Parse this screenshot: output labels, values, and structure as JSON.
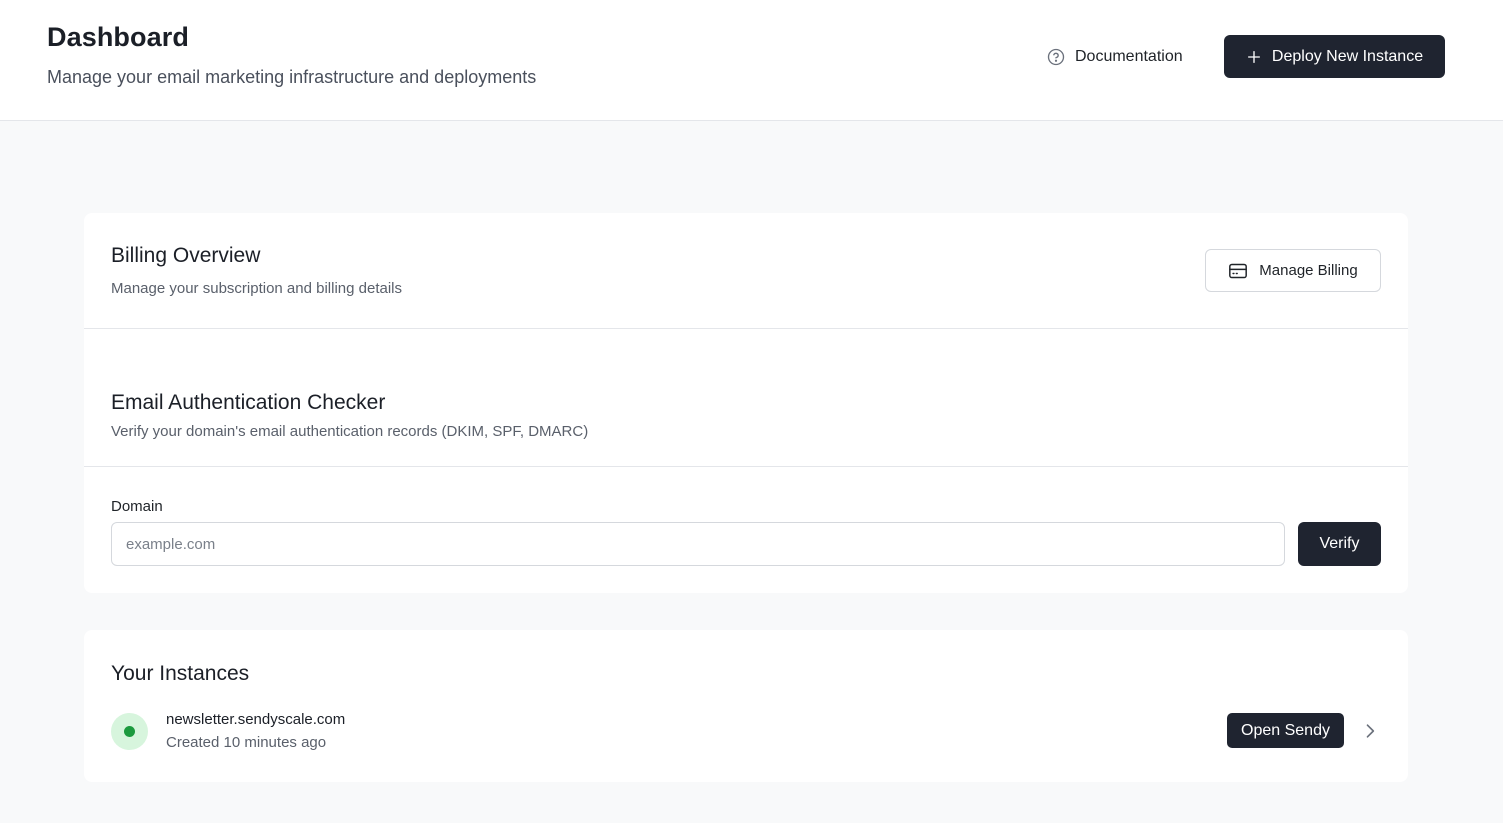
{
  "header": {
    "title": "Dashboard",
    "subtitle": "Manage your email marketing infrastructure and deployments",
    "documentation_label": "Documentation",
    "deploy_label": "Deploy New Instance"
  },
  "billing": {
    "title": "Billing Overview",
    "description": "Manage your subscription and billing details",
    "manage_label": "Manage Billing"
  },
  "auth_checker": {
    "title": "Email Authentication Checker",
    "description": "Verify your domain's email authentication records (DKIM, SPF, DMARC)",
    "domain_label": "Domain",
    "domain_placeholder": "example.com",
    "domain_value": "",
    "verify_label": "Verify"
  },
  "instances": {
    "title": "Your Instances",
    "items": [
      {
        "name": "newsletter.sendyscale.com",
        "created": "Created 10 minutes ago",
        "status": "active",
        "open_label": "Open Sendy"
      }
    ]
  },
  "colors": {
    "primary_button": "#1f2430",
    "status_active": "#1c9a3e",
    "status_active_bg": "#d7f5dd",
    "page_bg": "#f8f9fa"
  },
  "icons": {
    "documentation": "help-circle-icon",
    "deploy": "plus-icon",
    "manage_billing": "credit-card-icon",
    "instance_row": "chevron-right-icon"
  }
}
